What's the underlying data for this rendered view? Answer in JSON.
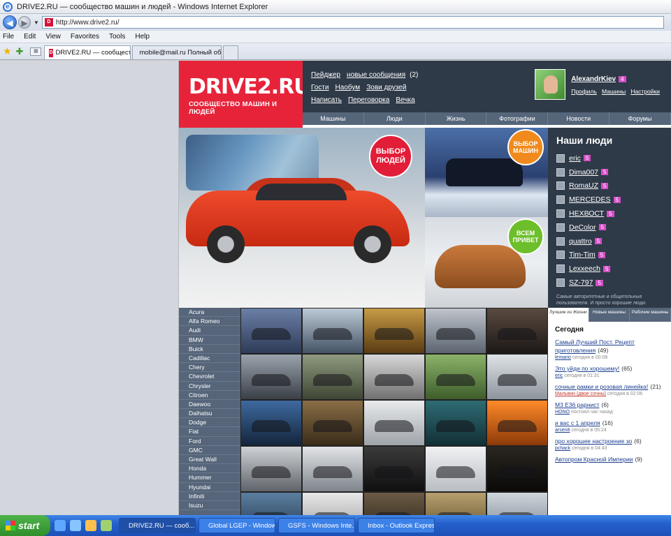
{
  "window": {
    "title": "DRIVE2.RU — сообщество машин и людей - Windows Internet Explorer"
  },
  "browser": {
    "address": "http://www.drive2.ru/",
    "menu": [
      "File",
      "Edit",
      "View",
      "Favorites",
      "Tools",
      "Help"
    ],
    "tabs": [
      {
        "label": "DRIVE2.RU — сообщест..."
      },
      {
        "label": "mobile@mail.ru Полный обо..."
      }
    ]
  },
  "site": {
    "logo_title": "DRIVE2.RU",
    "logo_subtitle": "СООБЩЕСТВО МАШИН И ЛЮДЕЙ",
    "header_links": {
      "pager": "Пейджер",
      "new_messages": "новые сообщения",
      "new_count": "(2)",
      "guests": "Гости",
      "bookmarks": "Наобум",
      "invite": "Зови друзей",
      "write": "Написать",
      "chat": "Переговорка",
      "venue": "Вечка"
    },
    "user": {
      "name": "AlexandrKiev",
      "badge": "4",
      "profile": "Профиль",
      "cars": "Машины",
      "settings": "Настройки"
    },
    "nav": [
      "Машины",
      "Люди",
      "Жизнь",
      "Фотографии",
      "Новости",
      "Форумы"
    ],
    "hero_badge": "ВЫБОР ЛЮДЕЙ",
    "photo2_badge": "ВЫБОР МАШИН",
    "photo3_badge": "ВСЕМ ПРИВЕТ",
    "people_title": "Наши люди",
    "people": [
      {
        "name": "eric",
        "badge": "5"
      },
      {
        "name": "Dima007",
        "badge": "5"
      },
      {
        "name": "RomaUZ",
        "badge": "5"
      },
      {
        "name": "MERCEDES",
        "badge": "5"
      },
      {
        "name": "НЕХВОСТ",
        "badge": "5"
      },
      {
        "name": "DeColor",
        "badge": "5"
      },
      {
        "name": "quattro",
        "badge": "5"
      },
      {
        "name": "Tim-Tim",
        "badge": "5"
      },
      {
        "name": "Lexxeech",
        "badge": "5"
      },
      {
        "name": "SZ-797",
        "badge": "5"
      }
    ],
    "people_note": "Самые авторитетные и общительные пользователи. И просто хорошие люди.",
    "brands": [
      "Acura",
      "Alfa Romeo",
      "Audi",
      "BMW",
      "Buick",
      "Cadillac",
      "Chery",
      "Chevrolet",
      "Chrysler",
      "Citroen",
      "Daewoo",
      "Daihatsu",
      "Dodge",
      "Fiat",
      "Ford",
      "GMC",
      "Great Wall",
      "Honda",
      "Hummer",
      "Hyundai",
      "Infiniti",
      "Isuzu"
    ],
    "panel_tabs": [
      "Лучшие из Жизни",
      "Новые машины",
      "Рабочие машины"
    ],
    "today_title": "Сегодня",
    "posts": [
      {
        "title": "Самый Лучший Пост. Рецепт приготовления",
        "count": "(49)",
        "author": "lemario",
        "time": "сегодня в 00:08"
      },
      {
        "title": "Это уйди по хорошему!",
        "count": "(65)",
        "author": "eric",
        "time": "сегодня в 01:31"
      },
      {
        "title": "сочные рамки и розовая линейка!",
        "count": "(21)",
        "author": "Мальвин (двое сочны)",
        "time": "сегодня в 02:06"
      },
      {
        "title": "М3 Е36 рарнист",
        "count": "(6)",
        "author": "HONO",
        "time": "постоял час назад"
      },
      {
        "title": "и вас с 1 апреля",
        "count": "(16)",
        "author": "arsen8",
        "time": "сегодня в 05:24"
      },
      {
        "title": "про хорошее настроение зо",
        "count": "(6)",
        "author": "pchack",
        "time": "сегодня в 04:43"
      },
      {
        "title": "Автопром Красной Империи",
        "count": "(9)",
        "author": "",
        "time": ""
      }
    ]
  },
  "taskbar": {
    "start": "start",
    "tasks": [
      "DRIVE2.RU — сооб...",
      "Global LGEP - Window...",
      "GSFS - Windows Inte...",
      "Inbox - Outlook Express"
    ]
  },
  "colors": {
    "brand_red": "#e7233a",
    "header_dark": "#2f3a48",
    "nav_gray": "#55657a",
    "badge_pink": "#d54ec7"
  }
}
